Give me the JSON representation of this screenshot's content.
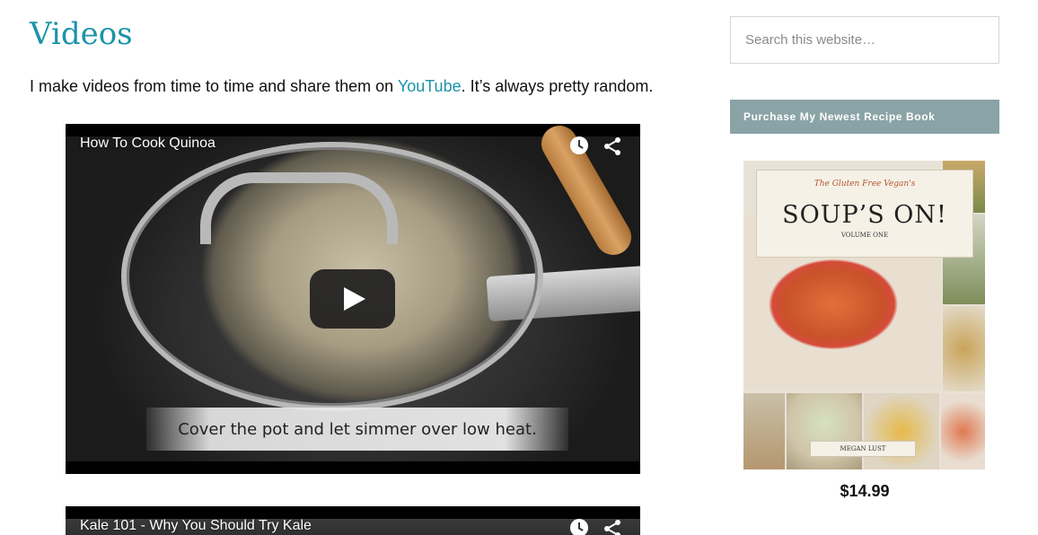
{
  "page": {
    "title": "Videos",
    "intro_before": "I make videos from time to time and share them on ",
    "intro_link": "YouTube",
    "intro_after": ". It’s always pretty random."
  },
  "videos": [
    {
      "title": "How To Cook Quinoa",
      "caption": "Cover the pot and let simmer over low heat."
    },
    {
      "title": "Kale 101 - Why You Should Try Kale"
    }
  ],
  "sidebar": {
    "search_placeholder": "Search this website…",
    "widget_title": "Purchase My Newest Recipe Book",
    "book": {
      "subtitle": "The Gluten Free Vegan's",
      "title": "SOUP’S ON!",
      "volume": "VOLUME ONE",
      "author": "MEGAN LUST",
      "price": "$14.99"
    }
  },
  "colors": {
    "accent": "#1a93a8",
    "widget_bg": "#8aa3a6"
  }
}
